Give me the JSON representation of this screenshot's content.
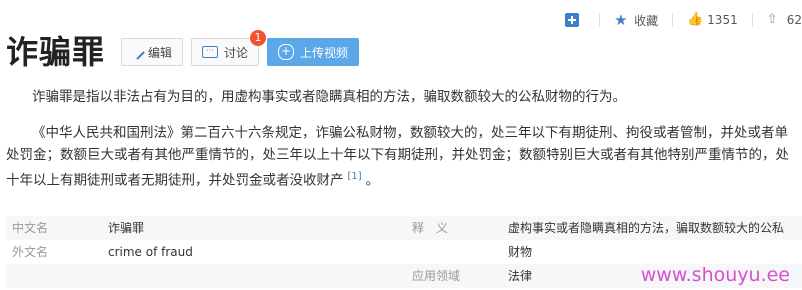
{
  "toolbar": {
    "add_label": "",
    "favorite_label": "收藏",
    "like_count": "1351",
    "share_count": "62"
  },
  "header": {
    "title": "诈骗罪",
    "edit_label": "编辑",
    "discuss_label": "讨论",
    "discuss_badge": "1",
    "upload_label": "上传视频"
  },
  "content": {
    "p1": "诈骗罪是指以非法占有为目的，用虚构事实或者隐瞒真相的方法，骗取数额较大的公私财物的行为。",
    "p2": "《中华人民共和国刑法》第二百六十六条规定，诈骗公私财物，数额较大的，处三年以下有期徒刑、拘役或者管制，并处或者单处罚金；数额巨大或者有其他严重情节的，处三年以上十年以下有期徒刑，并处罚金；数额特别巨大或者有其他特别严重情节的，处十年以上有期徒刑或者无期徒刑，并处罚金或者没收财产",
    "ref": "[1]",
    "p2_end": "。"
  },
  "info": {
    "rows": [
      {
        "label": "中文名",
        "value": "诈骗罪",
        "label2": "释　义",
        "value2": "虚构事实或者隐瞒真相的方法，骗取数额较大的公私"
      },
      {
        "label": "外文名",
        "value": "crime of fraud",
        "label2": "",
        "value2": "财物"
      },
      {
        "label": "",
        "value": "",
        "label2": "应用领域",
        "value2": "法律"
      }
    ]
  },
  "watermark": "www.shouyu.ee"
}
